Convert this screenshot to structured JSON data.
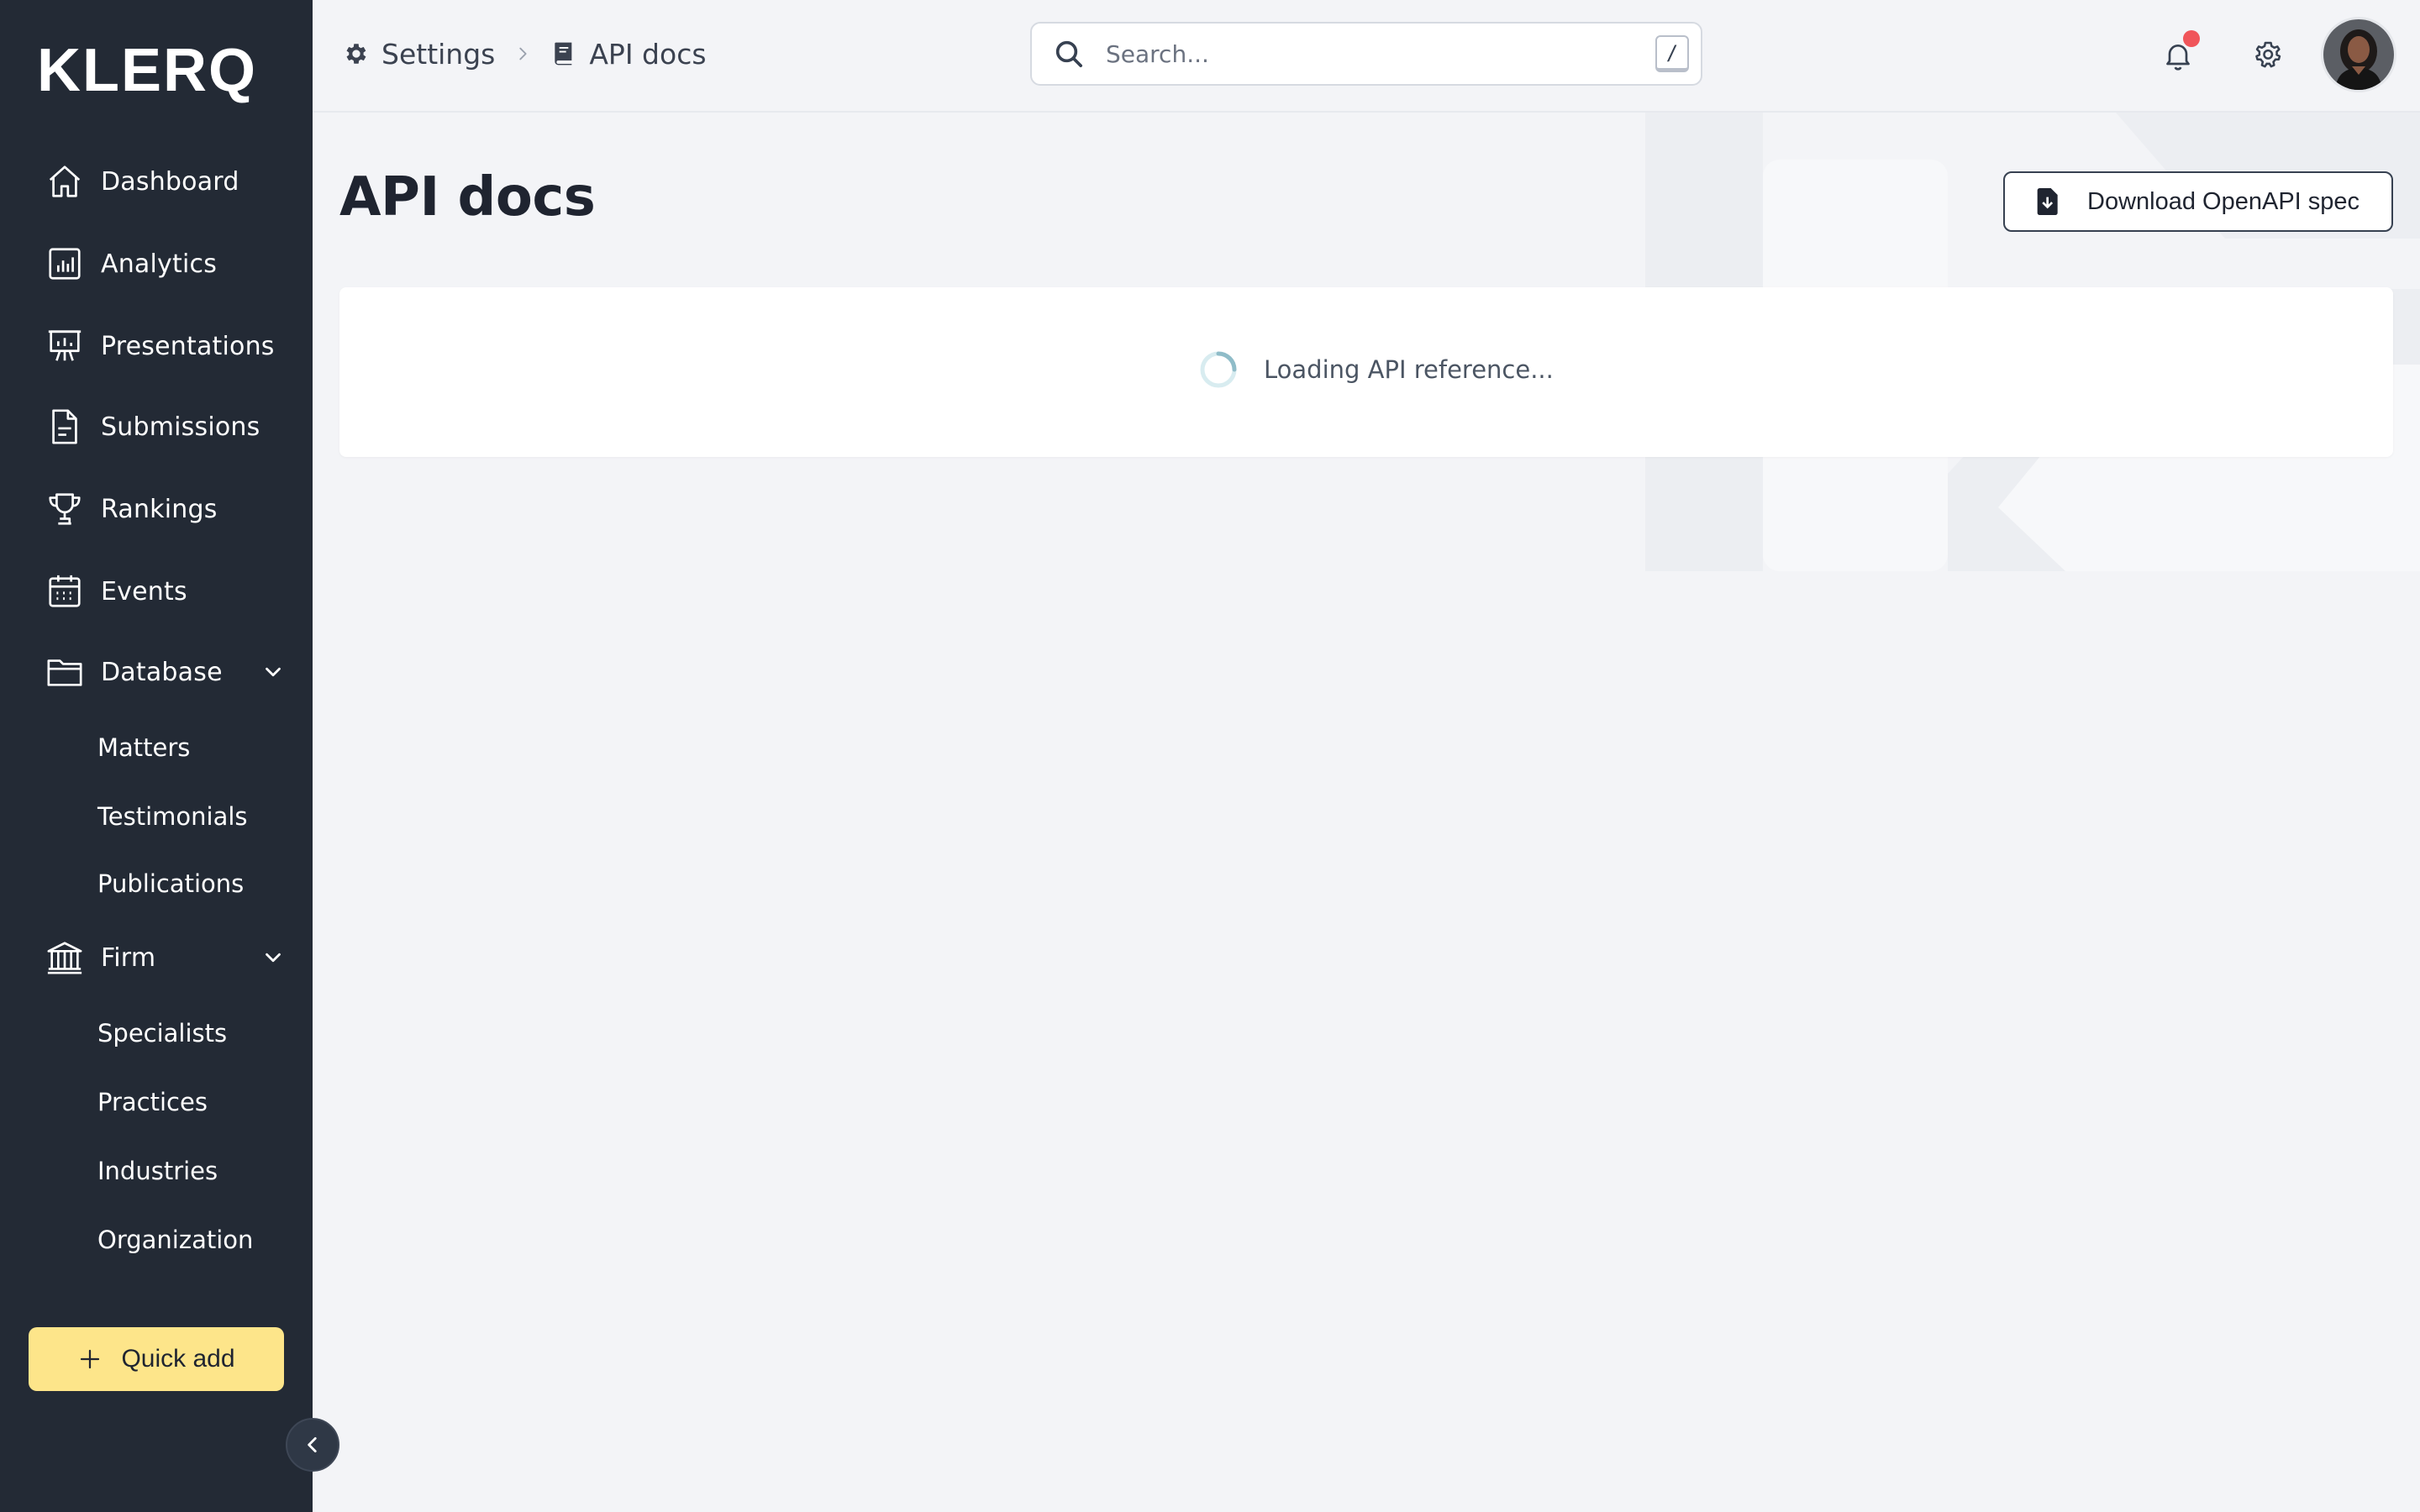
{
  "app": {
    "logo_text": "KLERQ"
  },
  "sidebar": {
    "items": [
      {
        "label": "Dashboard",
        "icon": "home-icon"
      },
      {
        "label": "Analytics",
        "icon": "analytics-icon"
      },
      {
        "label": "Presentations",
        "icon": "presentation-icon"
      },
      {
        "label": "Submissions",
        "icon": "document-icon"
      },
      {
        "label": "Rankings",
        "icon": "trophy-icon"
      },
      {
        "label": "Events",
        "icon": "calendar-icon"
      },
      {
        "label": "Database",
        "icon": "folder-icon",
        "expanded": true,
        "children": [
          "Matters",
          "Testimonials",
          "Publications"
        ]
      },
      {
        "label": "Firm",
        "icon": "bank-icon",
        "expanded": true,
        "children": [
          "Specialists",
          "Practices",
          "Industries",
          "Organization"
        ]
      }
    ],
    "quick_add_label": "Quick add"
  },
  "breadcrumb": {
    "items": [
      {
        "label": "Settings",
        "icon": "gear-icon"
      },
      {
        "label": "API docs",
        "icon": "book-icon"
      }
    ]
  },
  "search": {
    "placeholder": "Search...",
    "shortcut": "/"
  },
  "header": {
    "notification_has_unread": true,
    "colors": {
      "notification_dot": "#f0555a",
      "sidebar_bg": "#232a35",
      "accent_quick_add": "#fde58a",
      "page_bg": "#f3f4f7"
    }
  },
  "main": {
    "title": "API docs",
    "download_label": "Download OpenAPI spec",
    "loading_text": "Loading API reference..."
  }
}
